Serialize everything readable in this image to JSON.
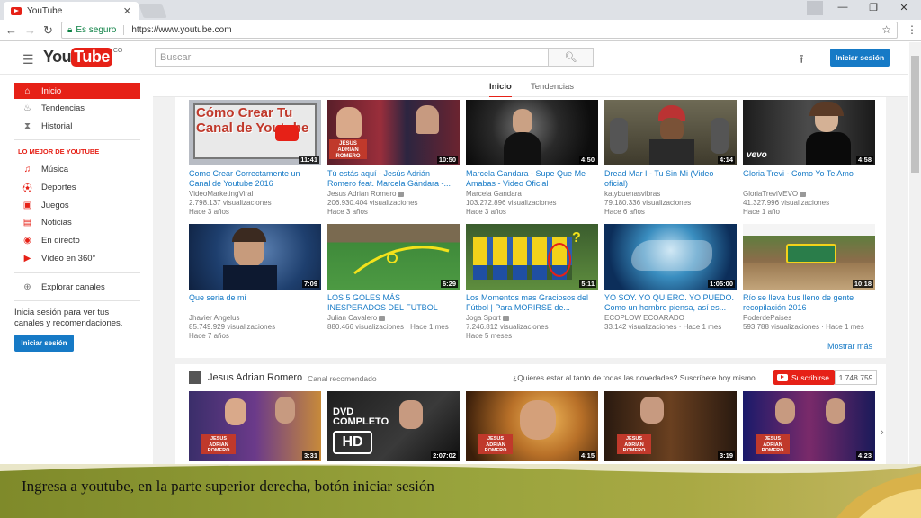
{
  "browser": {
    "tab_title": "YouTube",
    "tab_close": "✕",
    "secure_label": "Es seguro",
    "url": "https://www.youtube.com"
  },
  "youtube": {
    "logo_you": "You",
    "logo_tube": "Tube",
    "logo_country": "CO",
    "search_placeholder": "Buscar",
    "signin_label": "Iniciar sesión"
  },
  "sidebar": {
    "items": [
      {
        "label": "Inicio",
        "icon": "home-icon"
      },
      {
        "label": "Tendencias",
        "icon": "flame-icon"
      },
      {
        "label": "Historial",
        "icon": "hourglass-icon"
      }
    ],
    "section_title": "LO MEJOR DE YOUTUBE",
    "best": [
      {
        "label": "Música",
        "icon": "music-icon"
      },
      {
        "label": "Deportes",
        "icon": "sports-icon"
      },
      {
        "label": "Juegos",
        "icon": "games-icon"
      },
      {
        "label": "Noticias",
        "icon": "news-icon"
      },
      {
        "label": "En directo",
        "icon": "live-icon"
      },
      {
        "label": "Vídeo en 360°",
        "icon": "video360-icon"
      }
    ],
    "browse_channels": "Explorar canales",
    "signin_text": "Inicia sesión para ver tus canales y recomendaciones.",
    "signin_button": "Iniciar sesión"
  },
  "content_tabs": [
    "Inicio",
    "Tendencias"
  ],
  "videos_row1": [
    {
      "title": "Como Crear Correctamente un Canal de Youtube 2016",
      "channel": "VideoMarketingViral",
      "views": "2.798.137 visualizaciones",
      "age": "Hace 3 años",
      "duration": "11:41",
      "thumb_text": "Cómo Crear Tu Canal de Youtube",
      "verified": false
    },
    {
      "title": "Tú estás aquí - Jesús Adrián Romero feat. Marcela Gándara -...",
      "channel": "Jesus Adrian Romero",
      "views": "206.930.404 visualizaciones",
      "age": "Hace 3 años",
      "duration": "10:50",
      "thumb_text": "",
      "verified": true
    },
    {
      "title": "Marcela Gandara - Supe Que Me Amabas - Video Oficial",
      "channel": "Marcela Gandara",
      "views": "103.272.896 visualizaciones",
      "age": "Hace 3 años",
      "duration": "4:50",
      "thumb_text": "",
      "verified": false
    },
    {
      "title": "Dread Mar I - Tu Sin Mi (Video oficial)",
      "channel": "katybuenasvibras",
      "views": "79.180.336 visualizaciones",
      "age": "Hace 6 años",
      "duration": "4:14",
      "thumb_text": "",
      "verified": false
    },
    {
      "title": "Gloria Trevi - Como Yo Te Amo",
      "channel": "GloriaTreviVEVO",
      "views": "41.327.996 visualizaciones",
      "age": "Hace 1 año",
      "duration": "4:58",
      "thumb_text": "vevo",
      "verified": true
    }
  ],
  "videos_row2": [
    {
      "title": "Que seria de mi",
      "channel": "Jhavier Angelus",
      "views": "85.749.929 visualizaciones",
      "age": "Hace 7 años",
      "duration": "7:09",
      "verified": false
    },
    {
      "title": "LOS 5 GOLES MÁS INESPERADOS DEL FUTBOL",
      "channel": "Julian Cavalero",
      "views": "880.466 visualizaciones",
      "age": "Hace 1 mes",
      "duration": "6:29",
      "verified": true
    },
    {
      "title": "Los Momentos mas Graciosos del Fútbol | Para MORIRSE de...",
      "channel": "Joga Sport",
      "views": "7.246.812 visualizaciones",
      "age": "Hace 5 meses",
      "duration": "5:11",
      "verified": true
    },
    {
      "title": "YO SOY. YO QUIERO. YO PUEDO. Como un hombre piensa, así es...",
      "channel": "ECOPLOW ECOARADO",
      "views": "33.142 visualizaciones",
      "age": "Hace 1 mes",
      "duration": "1:05:00",
      "verified": false
    },
    {
      "title": "Río se lleva bus lleno de gente recopilación 2016",
      "channel": "PoderdePaises",
      "views": "593.788 visualizaciones",
      "age": "Hace 1 mes",
      "duration": "10:18",
      "verified": false
    }
  ],
  "more_label": "Mostrar más",
  "shelf": {
    "channel": "Jesus Adrian Romero",
    "recommended": "Canal recomendado",
    "question": "¿Quieres estar al tanto de todas las novedades? Suscríbete hoy mismo.",
    "subscribe": "Suscribirse",
    "sub_count": "1.748.759",
    "durations": [
      "3:31",
      "2:07:02",
      "4:15",
      "3:19",
      "4:23"
    ],
    "thumb2_line1": "DVD",
    "thumb2_line2": "COMPLETO",
    "thumb2_badge": "HD"
  },
  "caption": "Ingresa a youtube, en la parte superior derecha, botón iniciar sesión",
  "colors": {
    "youtube_red": "#e62117",
    "link_blue": "#167ac6",
    "banner": "#98a33c"
  }
}
